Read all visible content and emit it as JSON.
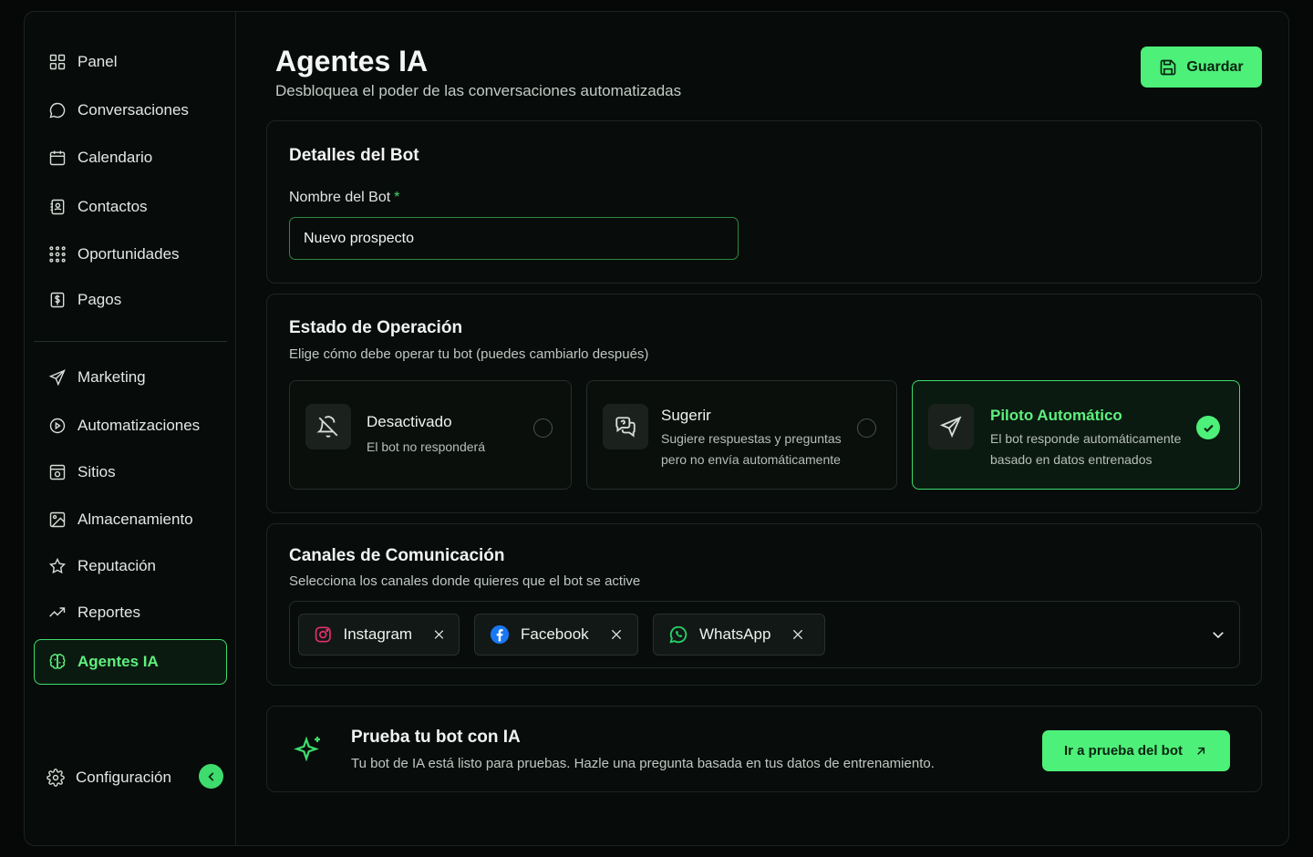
{
  "sidebar": {
    "items": [
      {
        "label": "Panel",
        "icon": "grid-icon"
      },
      {
        "label": "Conversaciones",
        "icon": "chat-bubble-icon"
      },
      {
        "label": "Calendario",
        "icon": "calendar-icon"
      },
      {
        "label": "Contactos",
        "icon": "contact-book-icon"
      },
      {
        "label": "Oportunidades",
        "icon": "network-icon"
      },
      {
        "label": "Pagos",
        "icon": "dollar-icon"
      },
      {
        "label": "Marketing",
        "icon": "send-icon"
      },
      {
        "label": "Automatizaciones",
        "icon": "play-circle-icon"
      },
      {
        "label": "Sitios",
        "icon": "site-icon"
      },
      {
        "label": "Almacenamiento",
        "icon": "image-icon"
      },
      {
        "label": "Reputación",
        "icon": "star-icon"
      },
      {
        "label": "Reportes",
        "icon": "trend-icon"
      },
      {
        "label": "Agentes IA",
        "icon": "brain-icon",
        "active": true
      }
    ],
    "settings_label": "Configuración"
  },
  "header": {
    "title": "Agentes IA",
    "subtitle": "Desbloquea el poder de las conversaciones automatizadas",
    "save_label": "Guardar"
  },
  "bot_details": {
    "title": "Detalles del Bot",
    "name_label": "Nombre del Bot",
    "required_mark": "*",
    "name_value": "Nuevo prospecto"
  },
  "operation": {
    "title": "Estado de Operación",
    "description": "Elige cómo debe operar tu bot (puedes cambiarlo después)",
    "modes": [
      {
        "title": "Desactivado",
        "desc_line1": "El bot no responderá",
        "desc_line2": "",
        "selected": false
      },
      {
        "title": "Sugerir",
        "desc_line1": "Sugiere respuestas y preguntas",
        "desc_line2": "pero no envía automáticamente",
        "selected": false
      },
      {
        "title": "Piloto Automático",
        "desc_line1": "El bot responde automáticamente",
        "desc_line2": "basado en datos entrenados",
        "selected": true
      }
    ]
  },
  "channels": {
    "title": "Canales de Comunicación",
    "description": "Selecciona los canales donde quieres que el bot se active",
    "selected": [
      {
        "label": "Instagram",
        "icon": "instagram-icon"
      },
      {
        "label": "Facebook",
        "icon": "facebook-icon"
      },
      {
        "label": "WhatsApp",
        "icon": "whatsapp-icon"
      }
    ]
  },
  "test": {
    "title": "Prueba tu bot con IA",
    "description": "Tu bot de IA está listo para pruebas. Hazle una pregunta basada en tus datos de entrenamiento.",
    "button_label": "Ir a prueba del bot"
  },
  "colors": {
    "accent": "#4df078",
    "background": "#050807",
    "card": "#080c0a"
  }
}
